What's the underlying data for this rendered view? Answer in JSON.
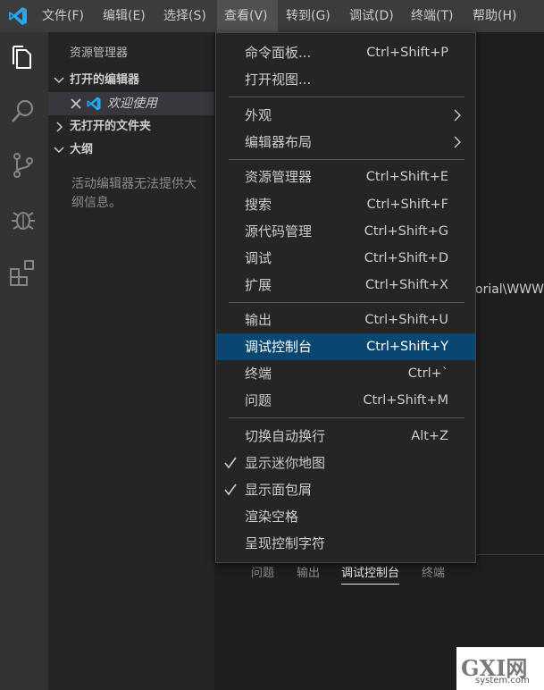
{
  "menubar": {
    "items": [
      "文件(F)",
      "编辑(E)",
      "选择(S)",
      "查看(V)",
      "转到(G)",
      "调试(D)",
      "终端(T)",
      "帮助(H)"
    ],
    "active_index": 3
  },
  "activity_bar": {
    "icons": [
      "files-icon",
      "search-icon",
      "source-control-icon",
      "debug-icon",
      "extensions-icon"
    ]
  },
  "sidebar": {
    "title": "资源管理器",
    "sections": {
      "open_editors": "打开的编辑器",
      "no_folder": "无打开的文件夹",
      "outline": "大纲"
    },
    "open_editor_file": "欢迎使用",
    "outline_message": "活动编辑器无法提供大纲信息。"
  },
  "editor": {
    "path_fragment": "orial\\WWW"
  },
  "panel": {
    "tabs": [
      "问题",
      "输出",
      "调试控制台",
      "终端"
    ],
    "active_index": 2
  },
  "view_menu": {
    "items": [
      {
        "label": "命令面板...",
        "shortcut": "Ctrl+Shift+P"
      },
      {
        "label": "打开视图...",
        "shortcut": ""
      },
      {
        "label": "外观",
        "shortcut": "",
        "submenu": true
      },
      {
        "label": "编辑器布局",
        "shortcut": "",
        "submenu": true
      },
      {
        "label": "资源管理器",
        "shortcut": "Ctrl+Shift+E"
      },
      {
        "label": "搜索",
        "shortcut": "Ctrl+Shift+F"
      },
      {
        "label": "源代码管理",
        "shortcut": "Ctrl+Shift+G"
      },
      {
        "label": "调试",
        "shortcut": "Ctrl+Shift+D"
      },
      {
        "label": "扩展",
        "shortcut": "Ctrl+Shift+X"
      },
      {
        "label": "输出",
        "shortcut": "Ctrl+Shift+U"
      },
      {
        "label": "调试控制台",
        "shortcut": "Ctrl+Shift+Y",
        "highlighted": true
      },
      {
        "label": "终端",
        "shortcut": "Ctrl+`"
      },
      {
        "label": "问题",
        "shortcut": "Ctrl+Shift+M"
      },
      {
        "label": "切换自动换行",
        "shortcut": "Alt+Z"
      },
      {
        "label": "显示迷你地图",
        "shortcut": "",
        "checked": true
      },
      {
        "label": "显示面包屑",
        "shortcut": "",
        "checked": true
      },
      {
        "label": "渲染空格",
        "shortcut": ""
      },
      {
        "label": "呈现控制字符",
        "shortcut": ""
      }
    ]
  },
  "watermark": {
    "main": "GXI网",
    "sub": "system.com"
  },
  "colors": {
    "accent": "#094771",
    "vscode_blue": "#23a9f2",
    "menubar": "#3c3c3c",
    "activitybar": "#333333",
    "sidebar": "#252526"
  }
}
